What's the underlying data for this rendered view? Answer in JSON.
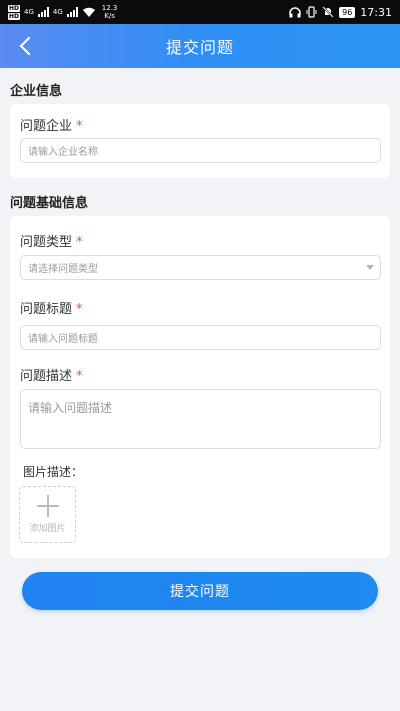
{
  "status_bar": {
    "hd1": "HD",
    "hd2": "HD",
    "net1": "4G",
    "net2": "4G",
    "speed_value": "12.3",
    "speed_unit": "K/s",
    "battery": "96",
    "time": "17:31"
  },
  "navbar": {
    "back_icon": "chevron-left-icon",
    "title": "提交问题"
  },
  "section_company": {
    "title": "企业信息",
    "field_label": "问题企业",
    "required_mark": "*",
    "placeholder": "请输入企业名称"
  },
  "section_basic": {
    "title": "问题基础信息",
    "type": {
      "label": "问题类型",
      "required_mark": "*",
      "placeholder": "请选择问题类型"
    },
    "headline": {
      "label": "问题标题",
      "required_mark": "*",
      "placeholder": "请输入问题标题"
    },
    "description": {
      "label": "问题描述",
      "required_mark": "*",
      "placeholder": "请输入问题描述"
    },
    "images": {
      "label": "图片描述：",
      "add_label": "添加图片"
    }
  },
  "submit_label": "提交问题",
  "colors": {
    "accent": "#1f83f1",
    "required": "#e5533a",
    "background": "#f1f3f6"
  }
}
